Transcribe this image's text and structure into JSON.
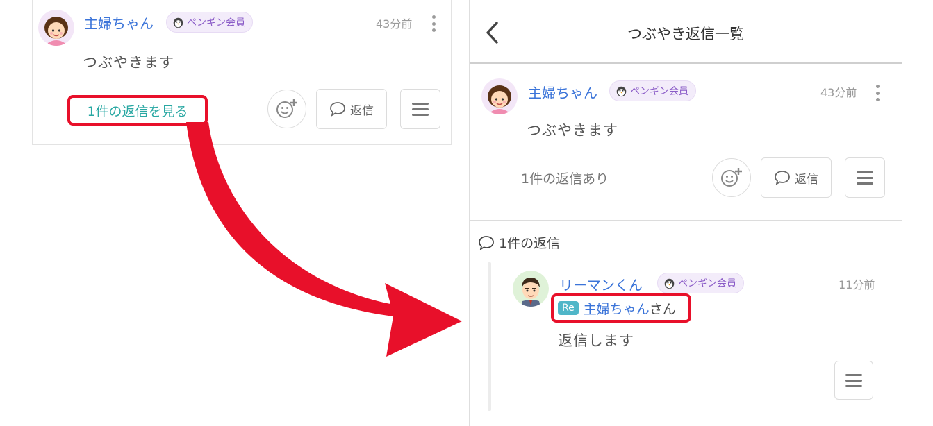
{
  "post": {
    "author": "主婦ちゃん",
    "badge": "ペンギン会員",
    "time": "43分前",
    "body": "つぶやきます",
    "view_replies_link": "1件の返信を見る",
    "reply_button_label": "返信"
  },
  "thread_panel": {
    "title": "つぶやき返信一覧",
    "post": {
      "author": "主婦ちゃん",
      "badge": "ペンギン会員",
      "time": "43分前",
      "body": "つぶやきます",
      "reply_count_text": "1件の返信あり",
      "reply_button_label": "返信"
    },
    "replies_heading": "1件の返信",
    "replies": [
      {
        "author": "リーマンくん",
        "badge": "ペンギン会員",
        "time": "11分前",
        "re_tag": "Re",
        "re_target": "主婦ちゃん",
        "re_suffix": "さん",
        "body": "返信します"
      }
    ]
  },
  "colors": {
    "name": "#3b74d9",
    "link": "#29a8a3",
    "badge_bg": "#f3ecfa",
    "badge_text": "#8a5bc7",
    "highlight": "#e8102a",
    "arrow": "#e8102a"
  },
  "icons": [
    "woman-avatar-icon",
    "man-avatar-icon",
    "penguin-icon",
    "kebab-menu-icon",
    "add-reaction-icon",
    "speech-bubble-icon",
    "hamburger-menu-icon",
    "back-chevron-icon",
    "curved-arrow-icon"
  ]
}
